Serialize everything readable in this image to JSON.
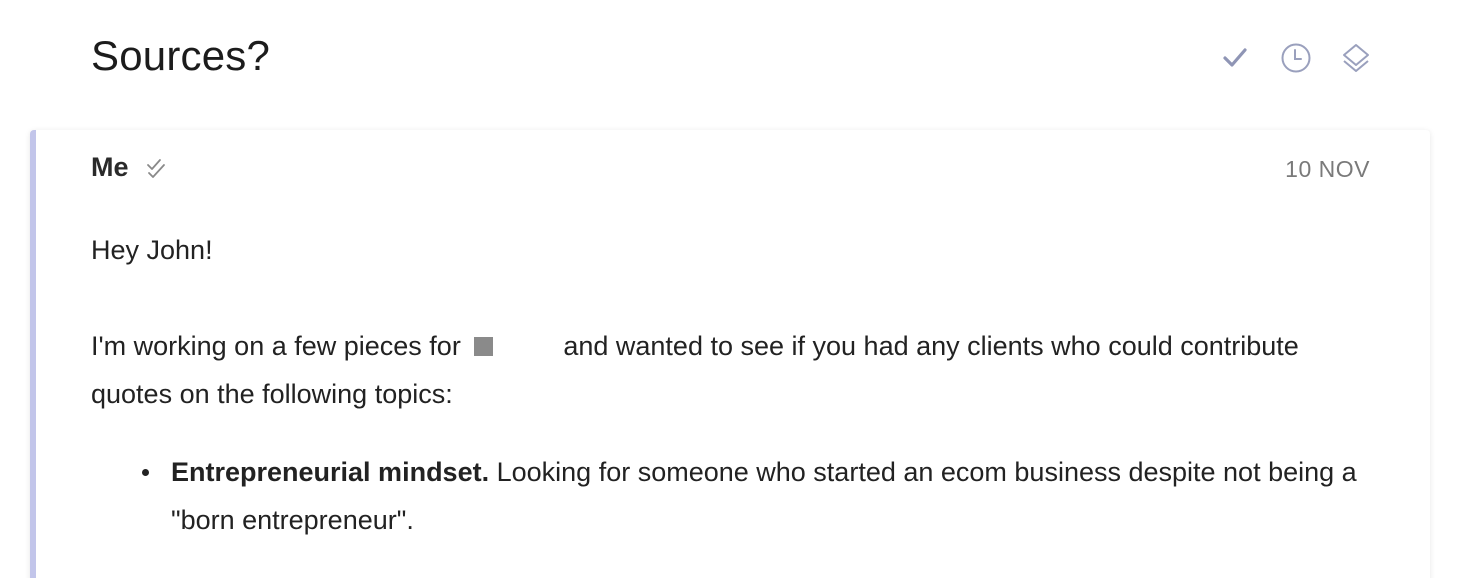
{
  "thread": {
    "subject": "Sources?"
  },
  "toolbar": {
    "done_icon": "checkmark-icon",
    "remind_icon": "clock-icon",
    "archive_icon": "layers-icon",
    "icon_color": "#8f95b5"
  },
  "message": {
    "sender": "Me",
    "date": "10 NOV",
    "read_icon": "double-check-icon",
    "accent_color": "#c2c5ea",
    "greeting": "Hey John!",
    "intro_before": "I'm working on a few pieces for",
    "intro_after": "and wanted to see if you had any clients who could contribute quotes on the following topics:",
    "topics": [
      {
        "title": "Entrepreneurial mindset.",
        "text": "Looking for someone who started an ecom business despite not being a \"born entrepreneur\"."
      }
    ]
  }
}
